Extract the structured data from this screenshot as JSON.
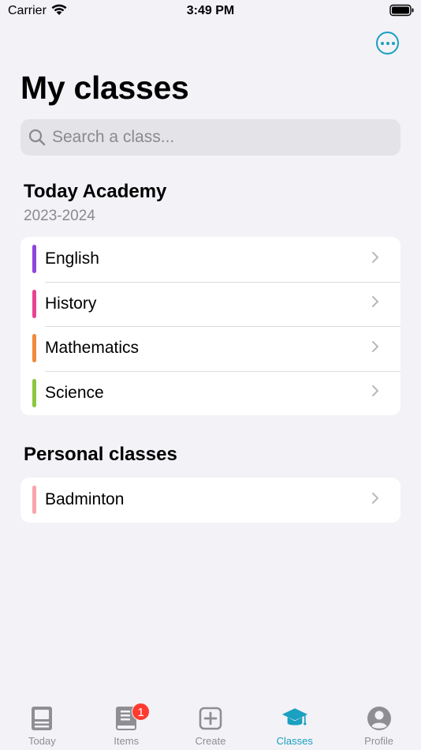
{
  "status_bar": {
    "carrier": "Carrier",
    "time": "3:49 PM"
  },
  "header": {
    "title": "My classes",
    "more_icon": "ellipsis-circle-icon"
  },
  "search": {
    "placeholder": "Search a class...",
    "value": ""
  },
  "sections": [
    {
      "title": "Today Academy",
      "subtitle": "2023-2024",
      "items": [
        {
          "label": "English",
          "color": "#8e44dd"
        },
        {
          "label": "History",
          "color": "#e84393"
        },
        {
          "label": "Mathematics",
          "color": "#f08a3c"
        },
        {
          "label": "Science",
          "color": "#8cc63f"
        }
      ]
    },
    {
      "title": "Personal classes",
      "items": [
        {
          "label": "Badminton",
          "color": "#f7a6ae"
        }
      ]
    }
  ],
  "tab_bar": {
    "accent": "#1aa0c0",
    "tabs": [
      {
        "label": "Today",
        "icon": "newspaper-icon"
      },
      {
        "label": "Items",
        "icon": "book-icon",
        "badge": "1"
      },
      {
        "label": "Create",
        "icon": "plus-square-icon"
      },
      {
        "label": "Classes",
        "icon": "graduation-cap-icon",
        "active": true
      },
      {
        "label": "Profile",
        "icon": "person-circle-icon"
      }
    ]
  }
}
